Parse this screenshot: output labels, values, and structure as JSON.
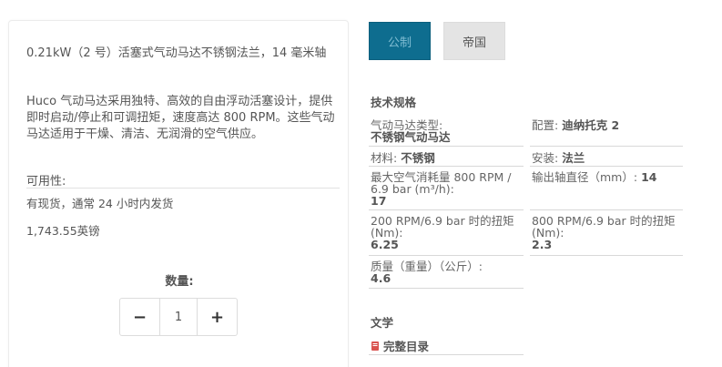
{
  "product": {
    "title": "0.21kW（2 号）活塞式气动马达不锈钢法兰，14 毫米轴",
    "description": "Huco 气动马达采用独特、高效的自由浮动活塞设计，提供即时启动/停止和可调扭矩，速度高达 800 RPM。这些气动马达适用于干燥、清洁、无润滑的空气供应。",
    "availability_label": "可用性:",
    "availability_value": "有现货，通常 24 小时内发货",
    "price": "1,743.55英镑",
    "quantity_label": "数量:",
    "quantity_value": "1",
    "minus_label": "−",
    "plus_label": "+"
  },
  "units": {
    "metric_label": "公制",
    "imperial_label": "帝国",
    "selected": "公制"
  },
  "specs": {
    "section_title": "技术规格",
    "motor_type_label": "气动马达类型:",
    "motor_type_value": "不锈钢气动马达",
    "config_label": "配置:",
    "config_value": "迪纳托克 2",
    "material_label": "材料:",
    "material_value": "不锈钢",
    "install_label": "安装:",
    "install_value": "法兰",
    "air_label": "最大空气消耗量 800 RPM / 6.9 bar (m³/h):",
    "air_value": "17",
    "shaft_label": "输出轴直径（mm）:",
    "shaft_value": "14",
    "torque200_label": "200 RPM/6.9 bar 时的扭矩 (Nm):",
    "torque200_value": "6.25",
    "torque800_label": "800 RPM/6.9 bar 时的扭矩 (Nm):",
    "torque800_value": "2.3",
    "mass_label": "质量（重量）（公斤）:",
    "mass_value": "4.6"
  },
  "literature": {
    "section_title": "文学",
    "catalog_link": "完整目录",
    "icon": "book-icon",
    "icon_color": "#d9534f"
  },
  "colors": {
    "accent": "#0e6d8f",
    "inactive_button": "#e4e4e4"
  }
}
